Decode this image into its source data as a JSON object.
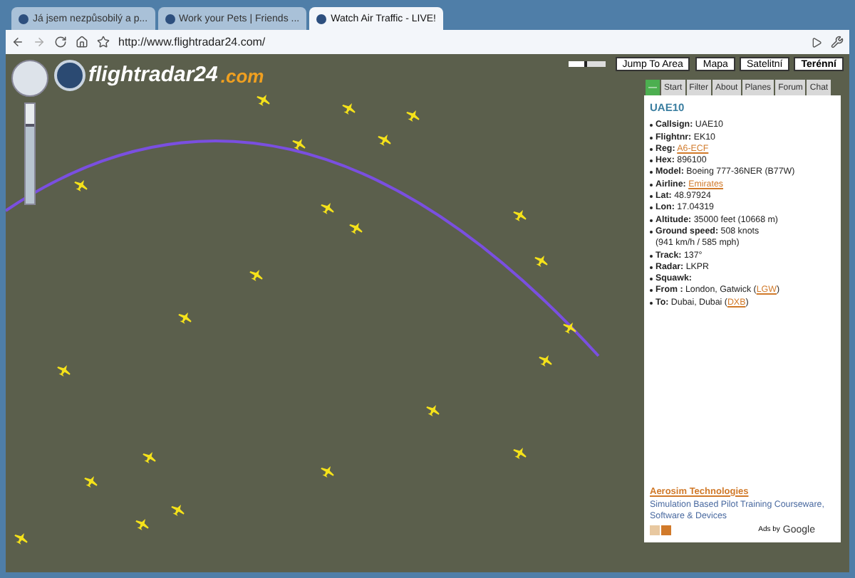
{
  "browser_tabs": [
    {
      "title": "Já jsem nezpůsobilý a p...",
      "selected": false
    },
    {
      "title": "Work your Pets | Friends ...",
      "selected": false
    },
    {
      "title": "Watch Air Traffic - LIVE!",
      "selected": true
    }
  ],
  "address": "http://www.flightradar24.com/",
  "zoom_slider": {
    "level": 0.8
  },
  "opacity_slider": {
    "level": 0.5
  },
  "logo": {
    "main": "flightradar24",
    "suffix": ".com"
  },
  "map_buttons": [
    {
      "label": "Jump To Area",
      "selected": false
    },
    {
      "label": "Mapa",
      "selected": false
    },
    {
      "label": "Satelitní",
      "selected": false
    },
    {
      "label": "Terénní",
      "selected": true
    }
  ],
  "panel_tabs": [
    {
      "label": "—",
      "selected": true
    },
    {
      "label": "Start",
      "selected": false
    },
    {
      "label": "Filter",
      "selected": false
    },
    {
      "label": "About",
      "selected": false
    },
    {
      "label": "Planes",
      "selected": false
    },
    {
      "label": "Forum",
      "selected": false
    },
    {
      "label": "Chat",
      "selected": false
    }
  ],
  "flight": {
    "title": "UAE10",
    "fields": [
      {
        "label": "Callsign:",
        "text": "UAE10"
      },
      {
        "label": "Flightnr:",
        "text": "EK10"
      },
      {
        "label": "Reg:",
        "link": "A6-ECF"
      },
      {
        "label": "Hex:",
        "text": "896100"
      },
      {
        "label": "Model:",
        "text": "Boeing 777-36NER (B77W)"
      },
      {
        "label": "Airline:",
        "link": "Emirates"
      },
      {
        "label": "Lat:",
        "text": "48.97924"
      },
      {
        "label": "Lon:",
        "text": "17.04319"
      },
      {
        "label": "Altitude:",
        "text": "35000 feet (10668 m)"
      },
      {
        "label": "Ground speed:",
        "text": "508 knots",
        "note": "(941 km/h / 585 mph)"
      },
      {
        "label": "Track:",
        "text": "137°"
      },
      {
        "label": "Radar:",
        "text": "LKPR"
      },
      {
        "label": "Squawk:"
      },
      {
        "label": "From :",
        "text": "London, Gatwick (",
        "link": "LGW",
        "after": ")"
      },
      {
        "label": "To:",
        "text": "Dubai, Dubai (",
        "link": "DXB",
        "after": ")"
      }
    ]
  },
  "ad": {
    "title": "Aerosim Technologies",
    "text": "Simulation Based Pilot Training Courseware, Software & Devices",
    "credit": "Ads by",
    "brand": "Google"
  }
}
